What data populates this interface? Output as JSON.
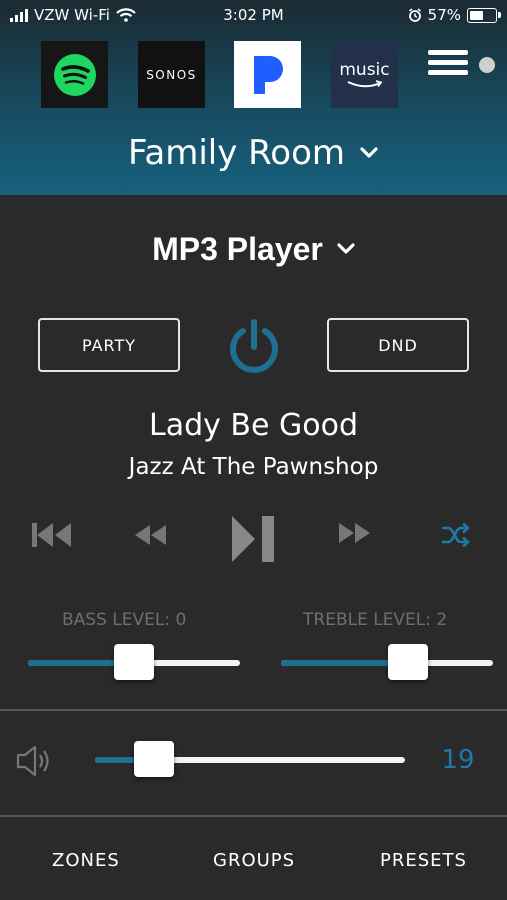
{
  "status_bar": {
    "carrier": "VZW Wi-Fi",
    "time": "3:02 PM",
    "battery_percent": "57%",
    "battery_level": 0.57
  },
  "services": [
    {
      "name": "spotify-icon"
    },
    {
      "label": "SONOS"
    },
    {
      "name": "pandora-icon"
    },
    {
      "label": "music"
    }
  ],
  "zone": {
    "title": "Family Room"
  },
  "source": {
    "title": "MP3 Player"
  },
  "modes": {
    "party": "PARTY",
    "dnd": "DND"
  },
  "track": {
    "title": "Lady Be Good",
    "album": "Jazz At The Pawnshop"
  },
  "tone": {
    "bass_label": "BASS LEVEL: 0",
    "treble_label": "TREBLE LEVEL: 2",
    "bass_position": 0.5,
    "treble_position": 0.6
  },
  "volume": {
    "value": "19",
    "position": 0.19
  },
  "colors": {
    "accent": "#1f6f93",
    "header": "#17617e",
    "background": "#2a2a2a"
  },
  "nav": {
    "zones": "ZONES",
    "groups": "GROUPS",
    "presets": "PRESETS"
  }
}
